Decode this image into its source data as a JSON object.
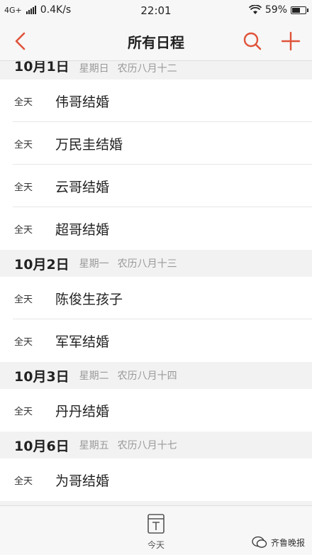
{
  "status_bar": {
    "network": "4G+",
    "speed": "0.4K/s",
    "time": "22:01",
    "battery": "59%",
    "battery_level": 0.59
  },
  "header": {
    "title": "所有日程",
    "back_icon": "chevron-left-icon",
    "search_icon": "search-icon",
    "add_icon": "plus-icon",
    "accent_color": "#e0533a"
  },
  "sections": [
    {
      "date": "10月1日",
      "weekday": "星期日",
      "lunar": "农历八月十二",
      "events": [
        {
          "allday": "全天",
          "title": "伟哥结婚"
        },
        {
          "allday": "全天",
          "title": "万民圭结婚"
        },
        {
          "allday": "全天",
          "title": "云哥结婚"
        },
        {
          "allday": "全天",
          "title": "超哥结婚"
        }
      ]
    },
    {
      "date": "10月2日",
      "weekday": "星期一",
      "lunar": "农历八月十三",
      "events": [
        {
          "allday": "全天",
          "title": "陈俊生孩子"
        },
        {
          "allday": "全天",
          "title": "军军结婚"
        }
      ]
    },
    {
      "date": "10月3日",
      "weekday": "星期二",
      "lunar": "农历八月十四",
      "events": [
        {
          "allday": "全天",
          "title": "丹丹结婚"
        }
      ]
    },
    {
      "date": "10月6日",
      "weekday": "星期五",
      "lunar": "农历八月十七",
      "events": [
        {
          "allday": "全天",
          "title": "为哥结婚"
        }
      ]
    }
  ],
  "bottom_bar": {
    "today_label": "今天",
    "today_icon": "calendar-today-icon",
    "watermark": "齐鲁晚报"
  }
}
